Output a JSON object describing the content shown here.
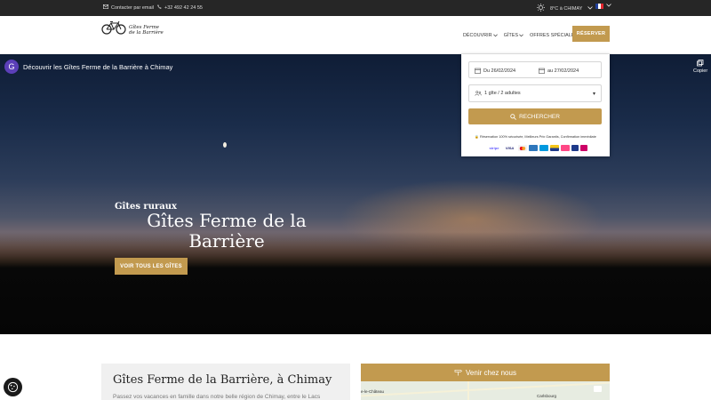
{
  "topbar": {
    "contact_label": "Contacter par email",
    "phone": "+32 492 42 24 55",
    "weather": "8°C  à CHIMAY",
    "language_flag": "fr"
  },
  "header": {
    "logo_line1": "Gîtes Ferme",
    "logo_line2": "de la Barrière",
    "nav": [
      {
        "label": "DÉCOUVRIR"
      },
      {
        "label": "GÎTES"
      },
      {
        "label": "OFFRES SPÉCIALES"
      }
    ],
    "book_label": "RÉSERVER"
  },
  "hero": {
    "video_avatar": "G",
    "video_title": "Découvrir les Gîtes Ferme de la Barrière à Chimay",
    "copy_label": "Copier",
    "subtitle": "Gîtes ruraux",
    "title": "Gîtes Ferme de la Barrière",
    "cta": "VOIR TOUS LES GÎTES"
  },
  "booking": {
    "date_from": "Du 26/02/2024",
    "date_to": "au 27/02/2024",
    "guests": "1 gîte / 2 adultes",
    "search_label": "RECHERCHER",
    "secure_note": "Réservation 100% sécurisée, Meilleurs Prix Garantis, Confirmation immédiate",
    "payments": [
      "stripe",
      "VISA",
      "mastercard",
      "amex",
      "maestro",
      "bancontact",
      "payconiq",
      "bc",
      "ideal"
    ]
  },
  "intro": {
    "title": "Gîtes Ferme de la Barrière, à Chimay",
    "text": "Passez vos vacances en famille dans notre belle région de Chimay, entre le Lacs"
  },
  "map": {
    "header": "Venir chez nous",
    "labels": [
      "e-le-Château",
      "Carlsbourg"
    ]
  },
  "colors": {
    "accent": "#c29a4f",
    "topbar": "#262626"
  }
}
